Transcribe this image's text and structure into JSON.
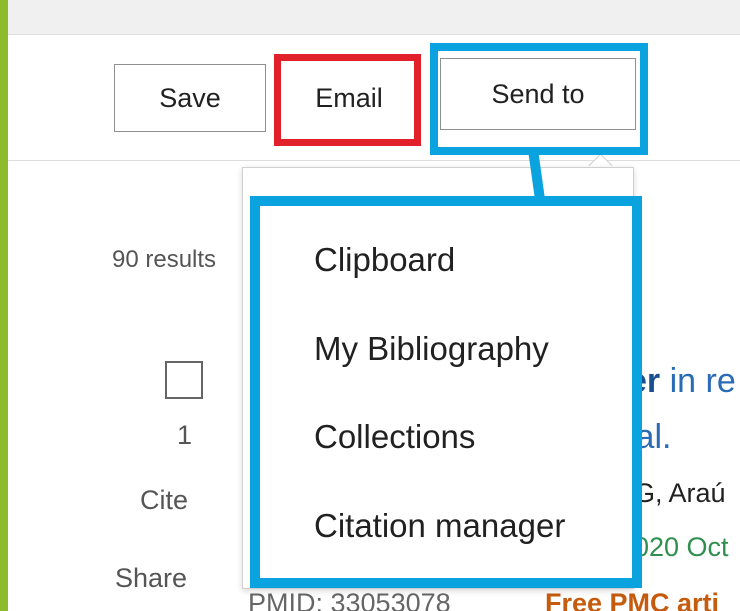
{
  "toolbar": {
    "save_label": "Save",
    "email_label": "Email",
    "send_to_label": "Send to"
  },
  "send_to_menu": {
    "items": [
      {
        "label": "Clipboard"
      },
      {
        "label": "My Bibliography"
      },
      {
        "label": "Collections"
      },
      {
        "label": "Citation manager"
      }
    ]
  },
  "results": {
    "count_text": "90 results",
    "item": {
      "number": "1",
      "cite_label": "Cite",
      "share_label": "Share",
      "title_bold_fragment": "er",
      "title_rest_line1": " in re",
      "title_line2": "ial.",
      "authors_fragment": "G, Araú",
      "journal_fragment": "020 Oct",
      "pmid_text": "PMID: 33053078",
      "free_pmc_text": "Free PMC arti"
    }
  },
  "colors": {
    "highlight_red": "#e2202a",
    "highlight_blue": "#0aa3e0",
    "frame_green": "#8dbb2c",
    "link_blue": "#2a6bb5"
  }
}
